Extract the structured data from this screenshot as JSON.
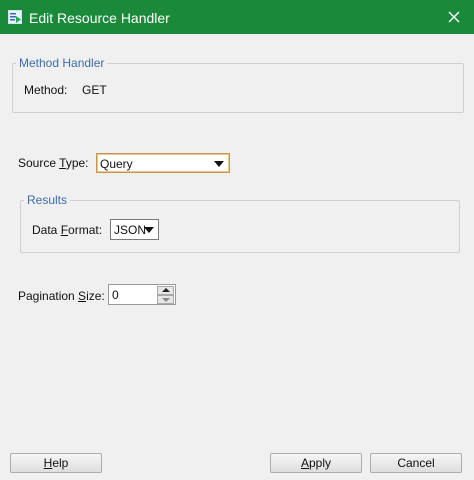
{
  "window": {
    "title": "Edit Resource Handler"
  },
  "method_handler": {
    "legend": "Method Handler",
    "method_label": "Method:",
    "method_value": "GET"
  },
  "source_type": {
    "label_pre": "Source ",
    "label_mnemonic": "T",
    "label_post": "ype:",
    "selected": "Query"
  },
  "results": {
    "legend": "Results",
    "format_label_pre": "Data ",
    "format_label_mnemonic": "F",
    "format_label_post": "ormat:",
    "format_selected": "JSON"
  },
  "pagination": {
    "label_pre": "Pagination ",
    "label_mnemonic": "S",
    "label_post": "ize:",
    "value": "0"
  },
  "buttons": {
    "help_mnemonic": "H",
    "help_rest": "elp",
    "apply_mnemonic": "A",
    "apply_rest": "pply",
    "cancel": "Cancel"
  },
  "colors": {
    "titlebar": "#1a8a3a",
    "legend_text": "#3d6ea6",
    "focus_border": "#c89646"
  }
}
